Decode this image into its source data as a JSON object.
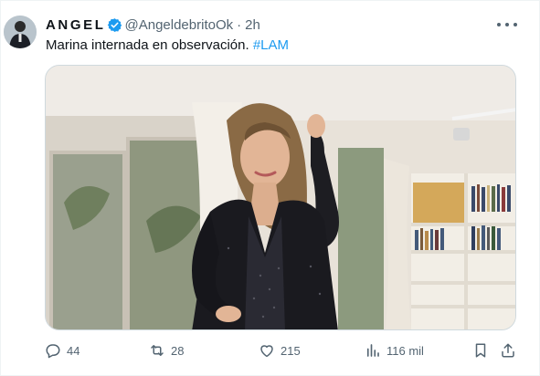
{
  "tweet": {
    "display_name": "ANGEL",
    "handle": "@AngeldebritoOk",
    "separator": "·",
    "time": "2h",
    "text_main": "Marina internada en observación. ",
    "hashtag": "#LAM"
  },
  "actions": {
    "replies": "44",
    "retweets": "28",
    "likes": "215",
    "views": "116 mil"
  },
  "icons": {
    "verified": "verified-badge-icon",
    "more": "more-options-icon",
    "reply": "reply-icon",
    "retweet": "retweet-icon",
    "like": "heart-icon",
    "views": "views-bar-chart-icon",
    "bookmark": "bookmark-icon",
    "share": "share-icon"
  },
  "colors": {
    "accent": "#1d9bf0",
    "text": "#0f1419",
    "secondary": "#536471"
  }
}
